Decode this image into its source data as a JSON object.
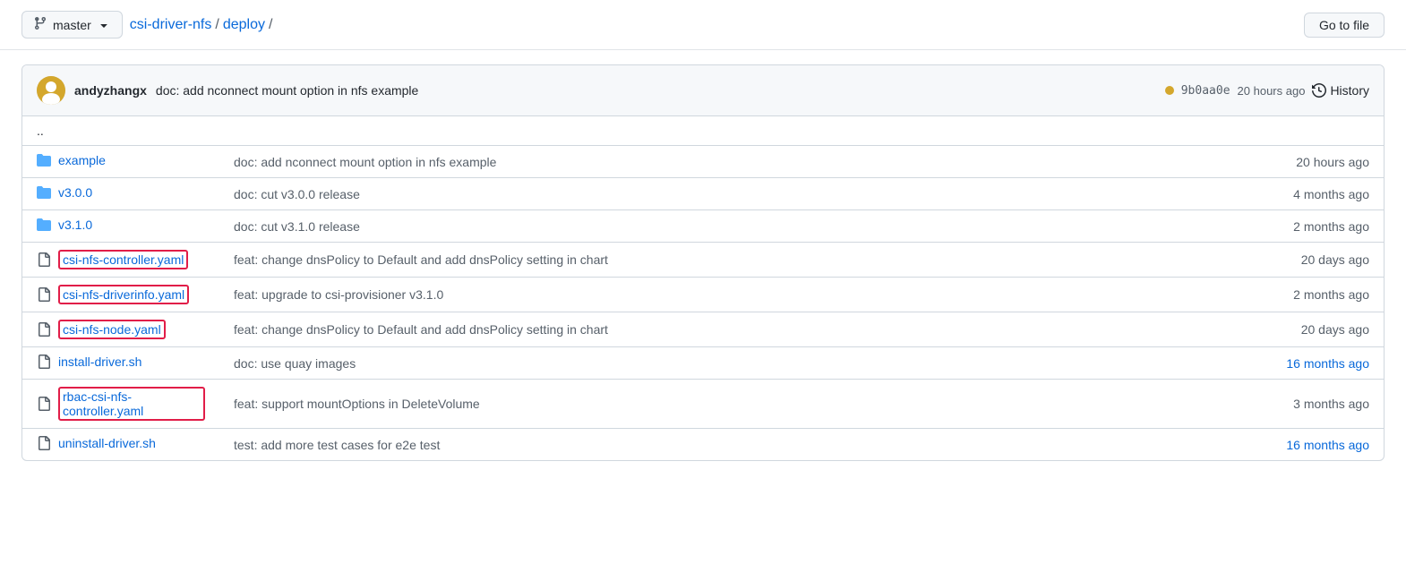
{
  "topbar": {
    "branch": "master",
    "branch_icon": "⑂",
    "breadcrumb": [
      {
        "text": "csi-driver-nfs",
        "href": "#",
        "type": "link"
      },
      {
        "text": "/",
        "type": "separator"
      },
      {
        "text": "deploy",
        "href": "#",
        "type": "link"
      },
      {
        "text": "/",
        "type": "separator"
      }
    ],
    "go_to_file": "Go to file"
  },
  "commit_bar": {
    "author": "andyzhangx",
    "message": "doc: add nconnect mount option in nfs example",
    "hash": "9b0aa0e",
    "time": "20 hours ago",
    "history": "History"
  },
  "parent_dir": "..",
  "files": [
    {
      "type": "dir",
      "name": "example",
      "message": "doc: add nconnect mount option in nfs example",
      "time": "20 hours ago",
      "highlighted": false,
      "time_blue": false
    },
    {
      "type": "dir",
      "name": "v3.0.0",
      "message": "doc: cut v3.0.0 release",
      "time": "4 months ago",
      "highlighted": false,
      "time_blue": false
    },
    {
      "type": "dir",
      "name": "v3.1.0",
      "message": "doc: cut v3.1.0 release",
      "time": "2 months ago",
      "highlighted": false,
      "time_blue": false
    },
    {
      "type": "file",
      "name": "csi-nfs-controller.yaml",
      "message": "feat: change dnsPolicy to Default and add dnsPolicy setting in chart",
      "time": "20 days ago",
      "highlighted": true,
      "time_blue": false
    },
    {
      "type": "file",
      "name": "csi-nfs-driverinfo.yaml",
      "message": "feat: upgrade to csi-provisioner v3.1.0",
      "time": "2 months ago",
      "highlighted": true,
      "time_blue": false
    },
    {
      "type": "file",
      "name": "csi-nfs-node.yaml",
      "message": "feat: change dnsPolicy to Default and add dnsPolicy setting in chart",
      "time": "20 days ago",
      "highlighted": true,
      "time_blue": false
    },
    {
      "type": "file",
      "name": "install-driver.sh",
      "message": "doc: use quay images",
      "time": "16 months ago",
      "highlighted": false,
      "time_blue": true
    },
    {
      "type": "file",
      "name": "rbac-csi-nfs-controller.yaml",
      "message": "feat: support mountOptions in DeleteVolume",
      "time": "3 months ago",
      "highlighted": true,
      "time_blue": false
    },
    {
      "type": "file",
      "name": "uninstall-driver.sh",
      "message": "test: add more test cases for e2e test",
      "time": "16 months ago",
      "highlighted": false,
      "time_blue": true
    }
  ]
}
